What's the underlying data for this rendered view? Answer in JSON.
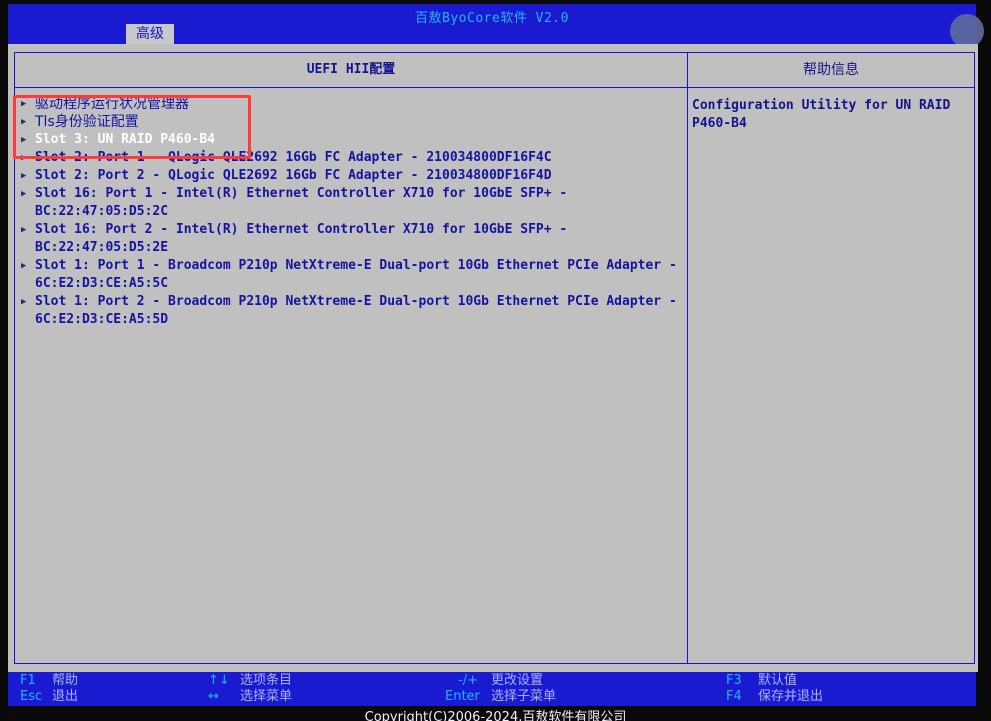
{
  "header": {
    "title": "百敖ByoCore软件 V2.0",
    "tab": "高级"
  },
  "left_panel": {
    "title": "UEFI HII配置"
  },
  "right_panel": {
    "title": "帮助信息",
    "help": "Configuration Utility for UN RAID P460-B4"
  },
  "menu": [
    {
      "label": "驱动程序运行状况管理器"
    },
    {
      "label": "Tls身份验证配置"
    },
    {
      "label": "Slot 3: UN RAID P460-B4",
      "selected": true
    },
    {
      "label": "Slot 2: Port 1 - QLogic QLE2692 16Gb FC Adapter - 210034800DF16F4C"
    },
    {
      "label": "Slot 2: Port 2 - QLogic QLE2692 16Gb FC Adapter - 210034800DF16F4D"
    },
    {
      "label": "Slot 16: Port 1 - Intel(R) Ethernet Controller X710 for 10GbE SFP+ -\nBC:22:47:05:D5:2C"
    },
    {
      "label": "Slot 16: Port 2 - Intel(R) Ethernet Controller X710 for 10GbE SFP+ -\nBC:22:47:05:D5:2E"
    },
    {
      "label": "Slot 1: Port 1 - Broadcom P210p NetXtreme-E Dual-port 10Gb Ethernet PCIe Adapter -\n6C:E2:D3:CE:A5:5C"
    },
    {
      "label": "Slot 1: Port 2 - Broadcom P210p NetXtreme-E Dual-port 10Gb Ethernet PCIe Adapter -\n6C:E2:D3:CE:A5:5D"
    }
  ],
  "footer": {
    "f1_key": "F1",
    "f1_desc": "帮助",
    "esc_key": "Esc",
    "esc_desc": "退出",
    "updown_key": "↑↓",
    "updown_desc": "选项条目",
    "leftright_key": "↔",
    "leftright_desc": "选择菜单",
    "plusminus_key": "-/+",
    "plusminus_desc": "更改设置",
    "enter_key": "Enter",
    "enter_desc": "选择子菜单",
    "f3_key": "F3",
    "f3_desc": "默认值",
    "f4_key": "F4",
    "f4_desc": "保存并退出"
  },
  "copyright": "Copyright(C)2006-2024,百敖软件有限公司",
  "colors": {
    "bar_blue": "#1a1ad0",
    "panel_gray": "#c0c0c0",
    "text_blue": "#1414a0",
    "key_cyan": "#1fb6ff",
    "highlight_red": "#ff3a3a"
  }
}
